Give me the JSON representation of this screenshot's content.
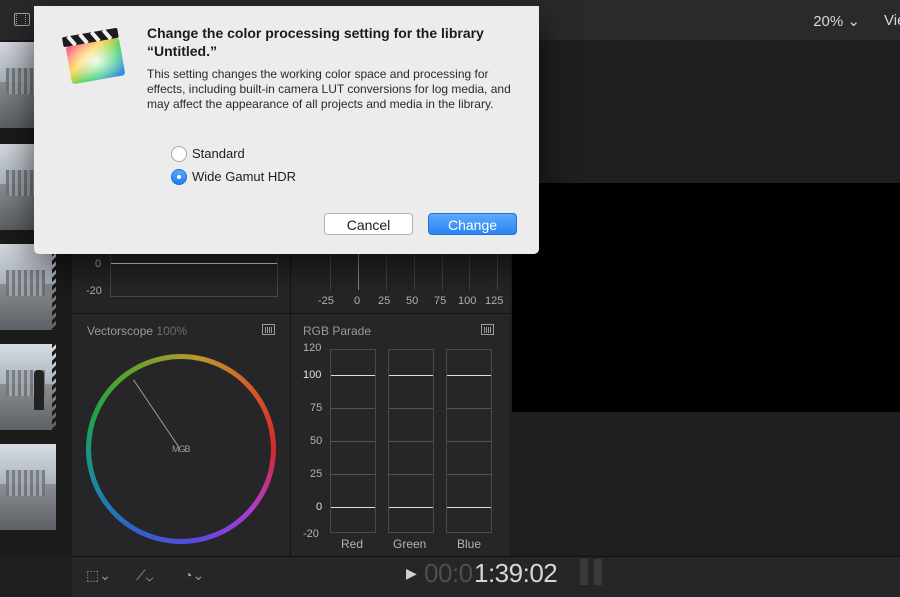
{
  "topbar": {
    "zoom": "20%",
    "zoom_chevron": "⌄",
    "view": "View"
  },
  "scopes": {
    "waveform": {
      "ticks": [
        "0",
        "-20"
      ]
    },
    "histogram": {
      "ticks": [
        "-25",
        "0",
        "25",
        "50",
        "75",
        "100",
        "125"
      ]
    },
    "vectorscope": {
      "label": "Vectorscope",
      "zoom": "100%",
      "center_label": "MGB"
    },
    "parade": {
      "label": "RGB Parade",
      "ticks": [
        "120",
        "100",
        "75",
        "50",
        "25",
        "0",
        "-20"
      ],
      "channels": [
        "Red",
        "Green",
        "Blue"
      ]
    }
  },
  "bottombar": {
    "timecode_dim": "00:0",
    "timecode": "1:39:02"
  },
  "dialog": {
    "title": "Change the color processing setting for the library “Untitled.”",
    "body": "This setting changes the working color space and processing for effects, including built-in camera LUT conversions for log media, and may affect the appearance of all projects and media in the library.",
    "options": [
      {
        "label": "Standard",
        "selected": false
      },
      {
        "label": "Wide Gamut HDR",
        "selected": true
      }
    ],
    "cancel": "Cancel",
    "confirm": "Change"
  },
  "icons": [
    "film-strip-icon",
    "chevron-down-icon",
    "scope-settings-icon",
    "crop-icon",
    "transform-icon",
    "speed-icon",
    "play-icon",
    "app-icon"
  ],
  "colors": {
    "accent": "#2a84f2",
    "dialog_bg": "#ececec",
    "app_bg": "#1f1f21"
  }
}
